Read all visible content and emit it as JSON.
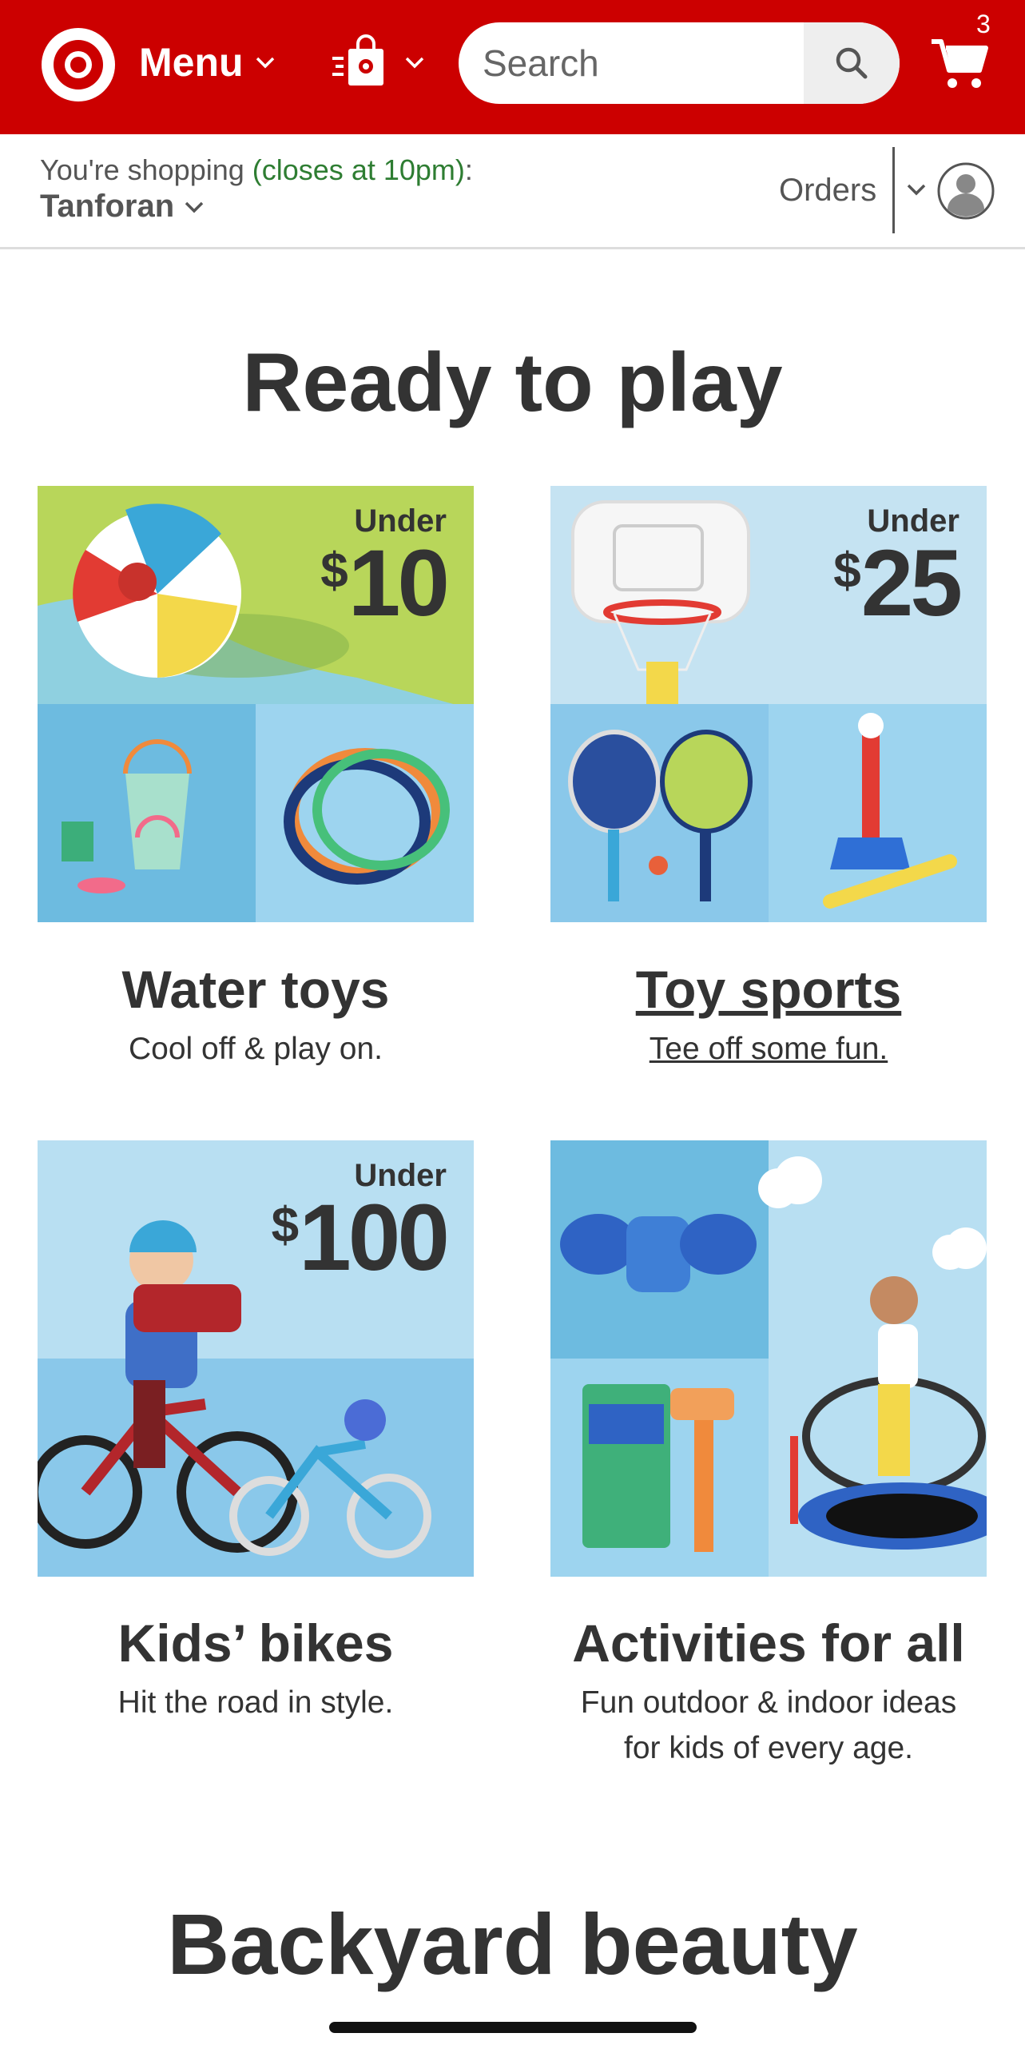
{
  "header": {
    "menu_label": "Menu",
    "search_placeholder": "Search",
    "cart_count": "3",
    "colors": {
      "brand_red": "#cc0000"
    }
  },
  "store_bar": {
    "shopping_prefix": "You're shopping",
    "closes_text": "(closes at 10pm)",
    "shopping_suffix": ":",
    "store_name": "Tanforan",
    "orders_label": "Orders"
  },
  "section": {
    "title": "Ready to play",
    "tiles": [
      {
        "badge_under": "Under",
        "badge_currency": "$",
        "badge_amount": "10",
        "title": "Water toys",
        "subtitle": "Cool off & play on."
      },
      {
        "badge_under": "Under",
        "badge_currency": "$",
        "badge_amount": "25",
        "title": "Toy sports",
        "subtitle": "Tee off some fun."
      },
      {
        "badge_under": "Under",
        "badge_currency": "$",
        "badge_amount": "100",
        "title": "Kids’ bikes",
        "subtitle": "Hit the road in style."
      },
      {
        "title": "Activities for all",
        "subtitle_line1": "Fun outdoor & indoor ideas",
        "subtitle_line2": "for kids of every age."
      }
    ]
  },
  "next_section": {
    "title": "Backyard beauty"
  },
  "icons": [
    "target-logo-icon",
    "chevron-down-icon",
    "order-pickup-bag-icon",
    "search-icon",
    "cart-icon",
    "user-avatar-icon"
  ]
}
